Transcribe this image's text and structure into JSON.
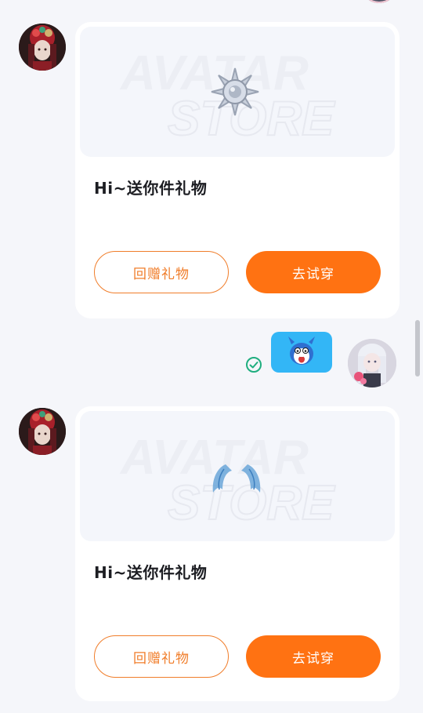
{
  "messages": [
    {
      "type": "gift",
      "watermark": "AVATAR STORE",
      "title": "Hi~送你件礼物",
      "return_gift_label": "回赠礼物",
      "try_on_label": "去试穿",
      "gift_item_icon": "spiked-orb-icon"
    },
    {
      "type": "sticker",
      "sticker_icon": "cartoon-character-sticker",
      "status": "sent-check-icon"
    },
    {
      "type": "gift",
      "watermark": "AVATAR STORE",
      "title": "Hi~送你件礼物",
      "return_gift_label": "回赠礼物",
      "try_on_label": "去试穿",
      "gift_item_icon": "blue-wings-icon"
    }
  ],
  "colors": {
    "background": "#f5f6fa",
    "card": "#ffffff",
    "accent_orange": "#ff7212",
    "outline_orange": "#f07d2a",
    "sticker_bubble": "#33b6f6",
    "check_green": "#1fae7f"
  }
}
